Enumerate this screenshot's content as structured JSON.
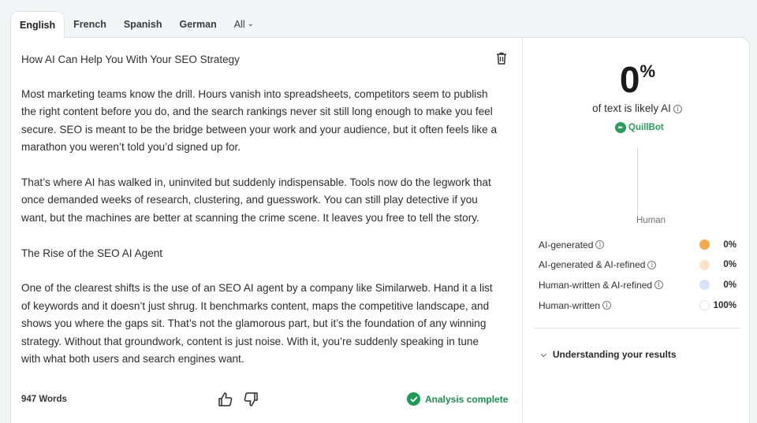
{
  "tabs": [
    {
      "label": "English",
      "active": true
    },
    {
      "label": "French"
    },
    {
      "label": "Spanish"
    },
    {
      "label": "German"
    },
    {
      "label": "All"
    }
  ],
  "editor": {
    "title": "How AI Can Help You With Your SEO Strategy",
    "paragraphs": [
      "Most marketing teams know the drill. Hours vanish into spreadsheets, competitors seem to publish the right content before you do, and the search rankings never sit still long enough to make you feel secure. SEO is meant to be the bridge between your work and your audience, but it often feels like a marathon you weren’t told you’d signed up for.",
      "That’s where AI has walked in, uninvited but suddenly indispensable. Tools now do the legwork that once demanded weeks of research, clustering, and guesswork. You can still play detective if you want, but the machines are better at scanning the crime scene. It leaves you free to tell the story.",
      "The Rise of the SEO AI Agent",
      "One of the clearest shifts is the use of an SEO AI agent by a company like Similarweb. Hand it a list of keywords and it doesn’t just shrug. It benchmarks content, maps the competitive landscape, and shows you where the gaps sit. That’s not the glamorous part, but it’s the foundation of any winning strategy. Without that groundwork, content is just noise. With it, you’re suddenly speaking in tune with what both users and search engines want."
    ],
    "word_count": "947 Words",
    "status": "Analysis complete"
  },
  "results": {
    "score": "0",
    "score_unit": "%",
    "likely_label": "of text is likely AI",
    "brand": "QuillBot",
    "bar_label": "Human",
    "legend": [
      {
        "label": "AI-generated",
        "value": "0%",
        "color": "#f4ab4f"
      },
      {
        "label": "AI-generated & AI-refined",
        "value": "0%",
        "color": "#fbe3c8"
      },
      {
        "label": "Human-written & AI-refined",
        "value": "0%",
        "color": "#d7e3f7"
      },
      {
        "label": "Human-written",
        "value": "100%",
        "color": "#ffffff"
      }
    ],
    "understanding": "Understanding your results"
  }
}
